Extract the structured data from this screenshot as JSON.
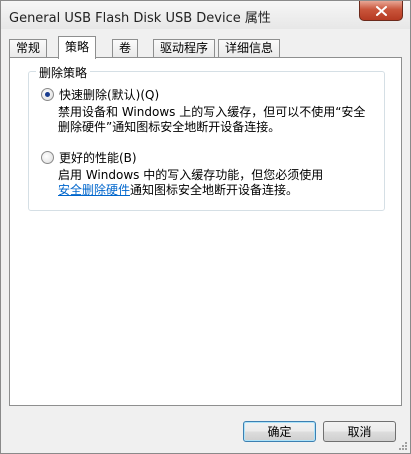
{
  "window": {
    "title": "General USB Flash Disk USB Device 属性"
  },
  "tabs": [
    {
      "label": "常规"
    },
    {
      "label": "策略"
    },
    {
      "label": "卷"
    },
    {
      "label": "驱动程序"
    },
    {
      "label": "详细信息"
    }
  ],
  "active_tab": "策略",
  "removal_policy": {
    "legend": "删除策略",
    "options": [
      {
        "label": "快速删除(默认)(Q)",
        "selected": true,
        "description_line1": "禁用设备和 Windows 上的写入缓存，但可以不使用“安全",
        "description_line2_link": "删除硬件",
        "description_line2_rest": "”通知图标安全地断开设备连接。"
      },
      {
        "label": "更好的性能(B)",
        "selected": false,
        "description_line1": "启用 Windows 中的写入缓存功能，但您必须使用",
        "description_line2_link": "安全删除硬件",
        "description_line2_rest": "通知图标安全地断开设备连接。"
      }
    ]
  },
  "buttons": {
    "ok": "确定",
    "cancel": "取消"
  },
  "colors": {
    "link": "#0066cc",
    "close_button": "#c9553b",
    "radio_dot": "#1a3d8f"
  }
}
